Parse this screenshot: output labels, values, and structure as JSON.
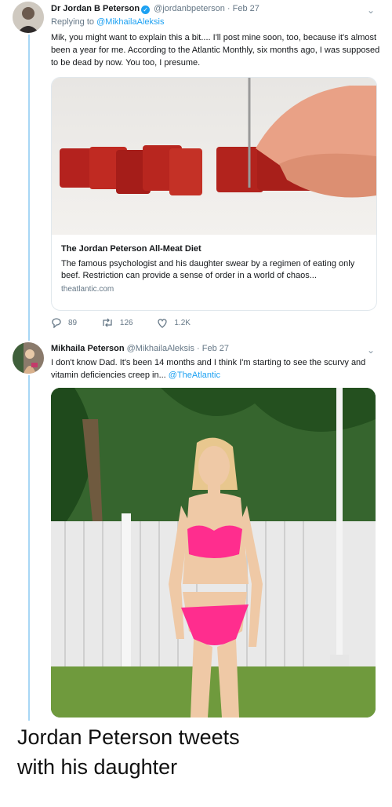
{
  "tweet1": {
    "name": "Dr Jordan B Peterson",
    "handle": "@jordanbpeterson",
    "date": "Feb 27",
    "replying_prefix": "Replying to",
    "replying_to": "@MikhailaAleksis",
    "text": "Mik, you might want to explain this a bit.... I'll post mine soon, too, because it's almost been a year for me. According to the Atlantic Monthly, six months ago, I was supposed to be dead by now. You too, I presume.",
    "card": {
      "title": "The Jordan Peterson All-Meat Diet",
      "description": "The famous psychologist and his daughter swear by a regimen of eating only beef. Restriction can provide a sense of order in a world of chaos...",
      "domain": "theatlantic.com"
    },
    "replies": "89",
    "retweets": "126",
    "likes": "1.2K"
  },
  "tweet2": {
    "name": "Mikhaila Peterson",
    "handle": "@MikhailaAleksis",
    "date": "Feb 27",
    "text": "I don't know Dad. It's been 14 months and I think I'm starting to see the scurvy and vitamin deficiencies creep in...",
    "mention": "@TheAtlantic"
  },
  "caption": "Jordan Peterson tweets with his daughter",
  "colors": {
    "link": "#1da1f2",
    "thread": "#a8d7f5",
    "bikini": "#ff2d8e"
  }
}
